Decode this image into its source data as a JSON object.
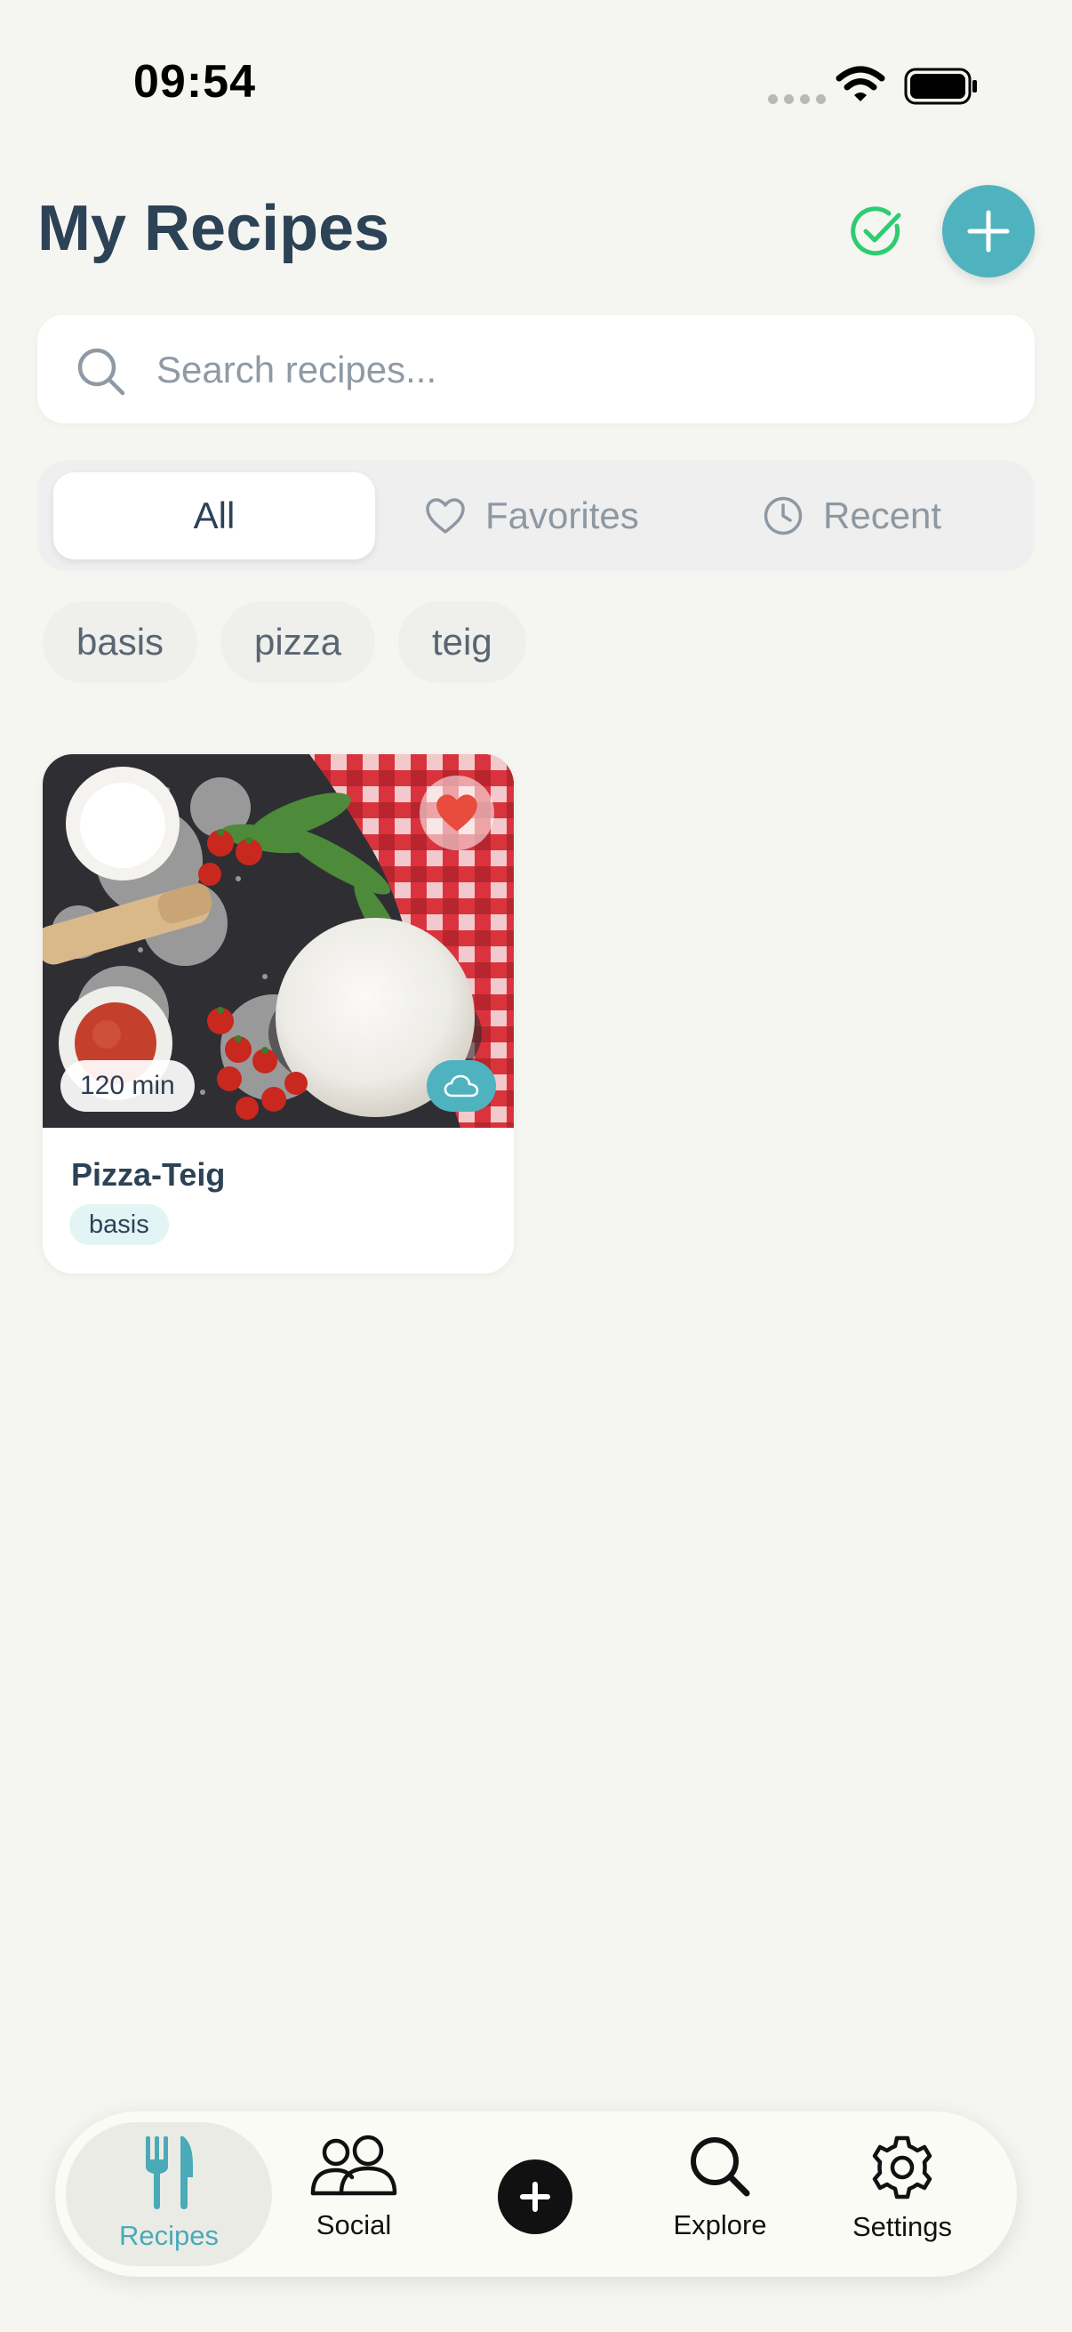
{
  "status": {
    "time": "09:54"
  },
  "header": {
    "title": "My Recipes"
  },
  "search": {
    "placeholder": "Search recipes..."
  },
  "tabs": [
    {
      "label": "All",
      "selected": true
    },
    {
      "label": "Favorites",
      "icon": "heart-icon"
    },
    {
      "label": "Recent",
      "icon": "clock-icon"
    }
  ],
  "tags": [
    "basis",
    "pizza",
    "teig"
  ],
  "recipes": [
    {
      "title": "Pizza-Teig",
      "time": "120 min",
      "tag": "basis",
      "favorite": true
    }
  ],
  "nav": {
    "recipes": "Recipes",
    "social": "Social",
    "explore": "Explore",
    "settings": "Settings"
  },
  "colors": {
    "accent": "#4fb3bf",
    "title": "#2c4256",
    "favorite": "#e74c3c",
    "sync": "#2ecc71"
  }
}
